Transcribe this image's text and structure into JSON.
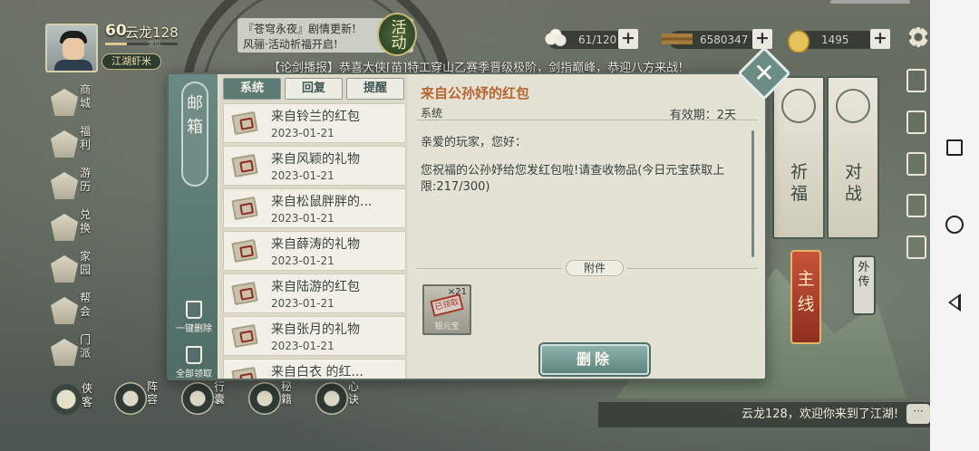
{
  "player": {
    "level": "60",
    "name": "云龙128",
    "vip": "·渔队",
    "rank": "江湖虾米"
  },
  "event_banner": {
    "line1": "『苍穹永夜』剧情更新!",
    "line2": "风骊·活动祈福开启!",
    "badge": "活动"
  },
  "resources": [
    {
      "icon": "steamed-bun-icon",
      "value": "61/120"
    },
    {
      "icon": "copper-coins-icon",
      "value": "6580347"
    },
    {
      "icon": "gold-ingot-icon",
      "value": "1495"
    }
  ],
  "broadcast": "【论剑播报】恭喜大侠[苗]特工穿山乙赛季晋级极阶，剑指巅峰，恭迎八方来战!",
  "left_menu": [
    {
      "label": "商城",
      "icon": "shop-icon"
    },
    {
      "label": "福利",
      "icon": "welfare-icon"
    },
    {
      "label": "游历",
      "icon": "travel-icon"
    },
    {
      "label": "兑换",
      "icon": "exchange-icon"
    },
    {
      "label": "家园",
      "icon": "home-icon"
    },
    {
      "label": "帮会",
      "icon": "guild-icon"
    },
    {
      "label": "门派",
      "icon": "sect-icon"
    }
  ],
  "hero_button": "侠客",
  "bottom_menu": [
    {
      "label": "阵容",
      "icon": "formation-icon"
    },
    {
      "label": "行囊",
      "icon": "bag-icon"
    },
    {
      "label": "秘籍",
      "icon": "manual-icon"
    },
    {
      "label": "心诀",
      "icon": "heart-art-icon"
    }
  ],
  "right_panel": {
    "pray": "祈福",
    "battle": "对战",
    "main_quest": "主线",
    "side_quest": "外传"
  },
  "chat_message": "云龙128，欢迎你来到了江湖!",
  "mail": {
    "title": "邮箱",
    "tabs": [
      "系统",
      "回复",
      "提醒"
    ],
    "active_tab": "系统",
    "side_actions": {
      "delete_all": "一键删除",
      "claim_all": "全部领取"
    },
    "items": [
      {
        "subject": "来自铃兰的红包",
        "date": "2023-01-21"
      },
      {
        "subject": "来自风颖的礼物",
        "date": "2023-01-21"
      },
      {
        "subject": "来自松鼠胖胖的...",
        "date": "2023-01-21"
      },
      {
        "subject": "来自薛涛的礼物",
        "date": "2023-01-21"
      },
      {
        "subject": "来自陆游的红包",
        "date": "2023-01-21"
      },
      {
        "subject": "来自张月的礼物",
        "date": "2023-01-21"
      },
      {
        "subject": "来自白衣 的红...",
        "date": ""
      }
    ],
    "detail": {
      "title": "来自公孙妤的红包",
      "sender": "系统",
      "expiry": "有效期：2天",
      "greeting": "亲爱的玩家，您好：",
      "body": "您祝福的公孙妤给您发红包啦!请查收物品(今日元宝获取上限:217/300)",
      "attachment_label": "附件",
      "attachment": {
        "name": "银元宝",
        "quantity": "×21",
        "stamp": "已领取"
      },
      "delete_label": "删除"
    }
  },
  "colors": {
    "accent": "#5d7c76",
    "title_orange": "#b8652f",
    "main_quest_red": "#a83f2a"
  }
}
